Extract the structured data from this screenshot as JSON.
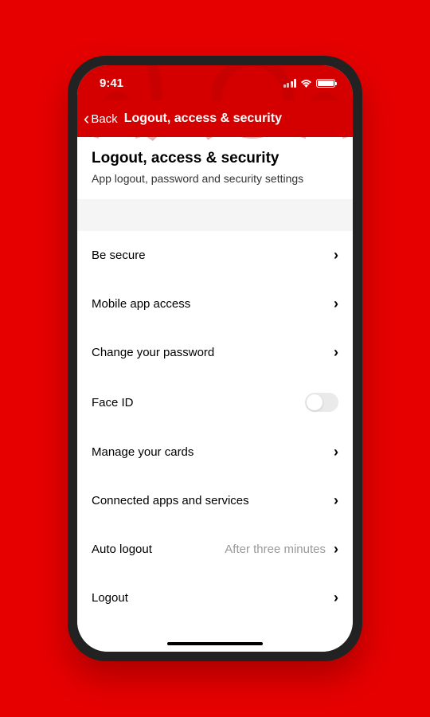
{
  "status": {
    "time": "9:41"
  },
  "nav": {
    "back_label": "Back",
    "title": "Logout, access & security"
  },
  "header": {
    "title": "Logout, access & security",
    "subtitle": "App logout, password and security settings"
  },
  "list": {
    "be_secure": "Be secure",
    "mobile_access": "Mobile app access",
    "change_password": "Change your password",
    "face_id": "Face ID",
    "face_id_enabled": false,
    "manage_cards": "Manage your cards",
    "connected_apps": "Connected apps and services",
    "auto_logout": "Auto logout",
    "auto_logout_value": "After three minutes",
    "logout": "Logout"
  }
}
